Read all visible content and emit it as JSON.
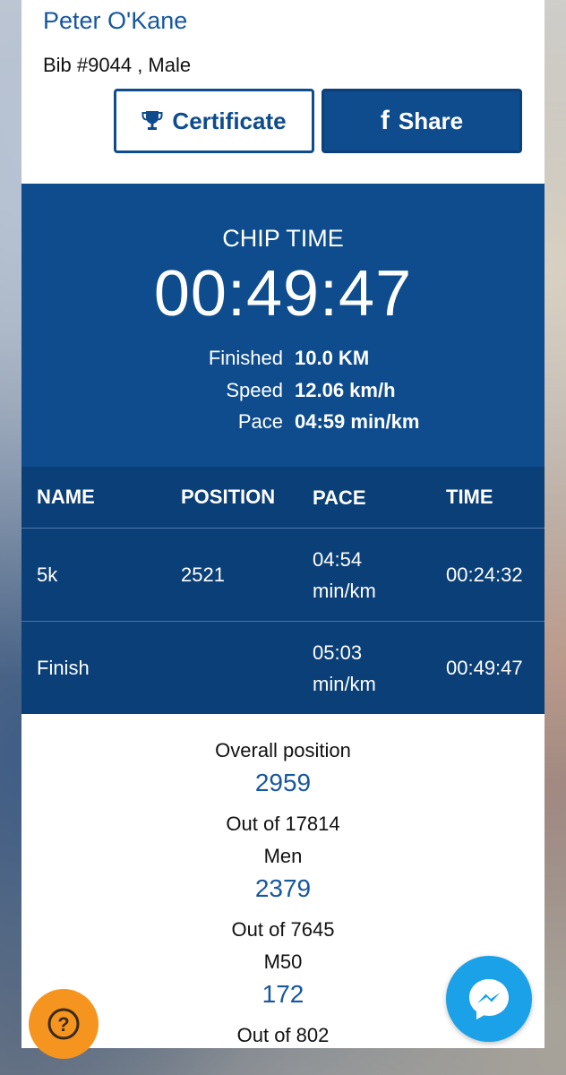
{
  "runner": {
    "name": "Peter O'Kane",
    "bib_line": "Bib #9044 , Male"
  },
  "actions": {
    "certificate_label": "Certificate",
    "share_label": "Share",
    "share_icon": "f"
  },
  "chip": {
    "label": "CHIP TIME",
    "time": "00:49:47",
    "stats": [
      {
        "label": "Finished",
        "value": "10.0 KM"
      },
      {
        "label": "Speed",
        "value": "12.06 km/h"
      },
      {
        "label": "Pace",
        "value": "04:59 min/km"
      }
    ]
  },
  "splits": {
    "columns": [
      "NAME",
      "POSITION",
      "PACE",
      "TIME"
    ],
    "rows": [
      {
        "name": "5k",
        "position": "2521",
        "pace_line1": "04:54",
        "pace_line2": "min/km",
        "time": "00:24:32"
      },
      {
        "name": "Finish",
        "position": "",
        "pace_line1": "05:03",
        "pace_line2": "min/km",
        "time": "00:49:47"
      }
    ]
  },
  "positions": [
    {
      "label": "Overall position",
      "value": "2959",
      "out_of": "Out of 17814"
    },
    {
      "label": "Men",
      "value": "2379",
      "out_of": "Out of 7645"
    },
    {
      "label": "M50",
      "value": "172",
      "out_of": "Out of 802"
    }
  ],
  "floating": {
    "help_icon": "?",
    "help_color": "#f5941f",
    "messenger_color": "#1ba1e8"
  },
  "colors": {
    "brand_blue": "#0e4c8e",
    "link_blue": "#1657a0"
  }
}
